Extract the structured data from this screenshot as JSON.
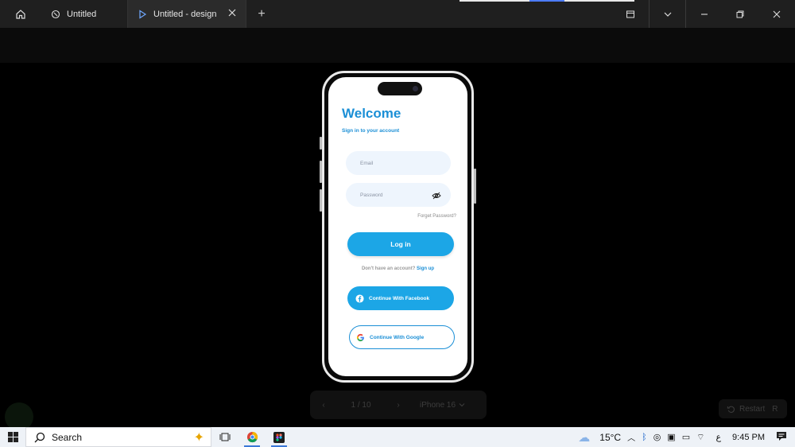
{
  "window": {
    "tabs": [
      {
        "label": "Untitled"
      },
      {
        "label": "Untitled - design"
      }
    ],
    "new_tab": "+"
  },
  "screen": {
    "title": "Welcome",
    "subtitle": "Sign in to your account",
    "email_placeholder": "Email",
    "password_placeholder": "Password",
    "forgot": "Forget Password?",
    "login": "Log in",
    "no_account": "Don't have an account?",
    "signup": "Sign up",
    "facebook": "Continue With Facebook",
    "google": "Continue With Google"
  },
  "prototype": {
    "page_indicator": "1 / 10",
    "device": "iPhone 16",
    "restart": "Restart",
    "restart_key": "R"
  },
  "taskbar": {
    "search": "Search",
    "temperature": "15°C",
    "language": "ع",
    "time": "9:45 PM"
  },
  "colors": {
    "accent": "#1ca6e6",
    "title": "#1b8fd6"
  }
}
